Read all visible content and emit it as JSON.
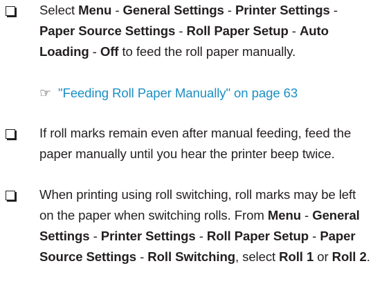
{
  "items": [
    {
      "segments": [
        {
          "t": "Select ",
          "b": false
        },
        {
          "t": "Menu",
          "b": true
        },
        {
          "t": " - ",
          "b": false
        },
        {
          "t": "General Settings",
          "b": true
        },
        {
          "t": " - ",
          "b": false
        },
        {
          "t": "Printer Settings",
          "b": true
        },
        {
          "t": " - ",
          "b": false
        },
        {
          "t": "Paper Source Settings",
          "b": true
        },
        {
          "t": " - ",
          "b": false
        },
        {
          "t": "Roll Paper Setup",
          "b": true
        },
        {
          "t": " - ",
          "b": false
        },
        {
          "t": "Auto Loading",
          "b": true
        },
        {
          "t": " - ",
          "b": false
        },
        {
          "t": "Off",
          "b": true
        },
        {
          "t": " to feed the roll paper manually.",
          "b": false
        }
      ],
      "link": {
        "icon": "pointing-hand-icon",
        "glyph": "☞",
        "text": "\"Feeding Roll Paper Manually\" on page 63"
      }
    },
    {
      "segments": [
        {
          "t": "If roll marks remain even after manual feeding, feed the paper manually until you hear the printer beep twice.",
          "b": false
        }
      ]
    },
    {
      "segments": [
        {
          "t": "When printing using roll switching, roll marks may be left on the paper when switching rolls. From ",
          "b": false
        },
        {
          "t": "Menu",
          "b": true
        },
        {
          "t": " - ",
          "b": false
        },
        {
          "t": "General Settings",
          "b": true
        },
        {
          "t": " - ",
          "b": false
        },
        {
          "t": "Printer Settings",
          "b": true
        },
        {
          "t": " - ",
          "b": false
        },
        {
          "t": "Roll Paper Setup",
          "b": true
        },
        {
          "t": " - ",
          "b": false
        },
        {
          "t": "Paper Source Settings",
          "b": true
        },
        {
          "t": " - ",
          "b": false
        },
        {
          "t": "Roll Switching",
          "b": true
        },
        {
          "t": ", select ",
          "b": false
        },
        {
          "t": "Roll 1",
          "b": true
        },
        {
          "t": " or ",
          "b": false
        },
        {
          "t": "Roll 2",
          "b": true
        },
        {
          "t": ".",
          "b": false
        }
      ]
    }
  ],
  "colors": {
    "text": "#231f20",
    "link": "#1a8fc4"
  }
}
